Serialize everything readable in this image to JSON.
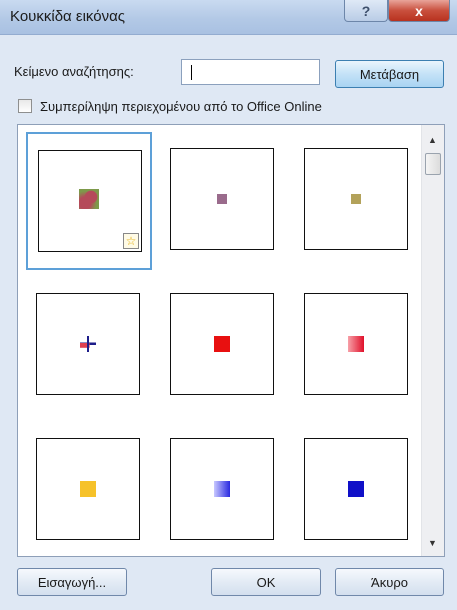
{
  "window": {
    "title": "Κουκκίδα εικόνας",
    "help_glyph": "?",
    "close_glyph": "x"
  },
  "search": {
    "label": "Κείμενο αναζήτησης:",
    "value": "",
    "go_button": "Μετάβαση"
  },
  "include_online": {
    "label": "Συμπερίληψη περιεχομένου από το Office Online",
    "checked": false
  },
  "bullets": [
    {
      "name": "bullet-floral-pink",
      "colors": [
        "#b54a5a",
        "#7d9a4a"
      ],
      "selected": true,
      "has_star_badge": true
    },
    {
      "name": "bullet-purple-small",
      "colors": [
        "#9a6b8c"
      ]
    },
    {
      "name": "bullet-olive-small",
      "colors": [
        "#b3a25a"
      ]
    },
    {
      "name": "bullet-crosshair",
      "colors": [
        "#1d1d8a",
        "#e04050",
        "#f0c020"
      ]
    },
    {
      "name": "bullet-red-square",
      "colors": [
        "#e81010"
      ]
    },
    {
      "name": "bullet-red-gradient",
      "colors": [
        "#f7a0a8",
        "#e0102a"
      ]
    },
    {
      "name": "bullet-gold-square",
      "colors": [
        "#f6c22a"
      ]
    },
    {
      "name": "bullet-blue-gradient",
      "colors": [
        "#c8c8ff",
        "#2a2ae0"
      ]
    },
    {
      "name": "bullet-navy-square",
      "colors": [
        "#1010c8"
      ]
    }
  ],
  "scrollbar": {
    "up_glyph": "▲",
    "down_glyph": "▼"
  },
  "buttons": {
    "import": "Εισαγωγή...",
    "ok": "OK",
    "cancel": "Άκυρο"
  },
  "badge_glyph": "☆"
}
